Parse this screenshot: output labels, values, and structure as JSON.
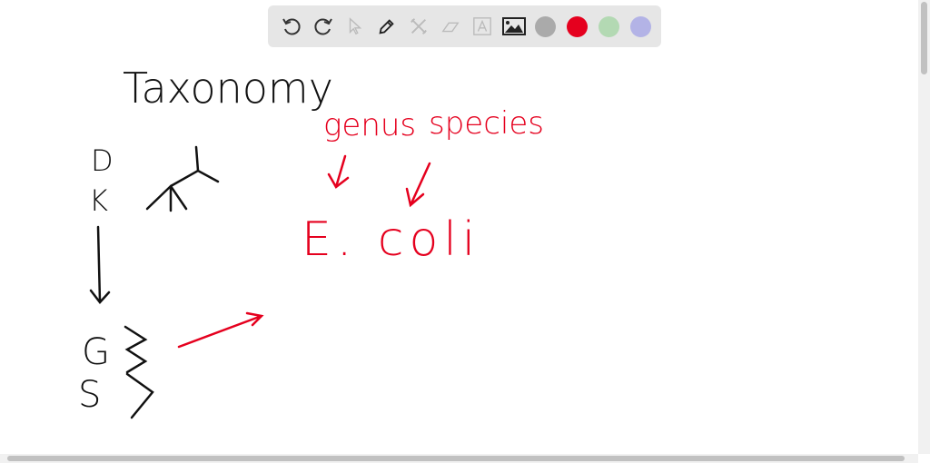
{
  "toolbar": {
    "tools": [
      "undo-icon",
      "redo-icon",
      "select-icon",
      "pen-icon",
      "tools-icon",
      "eraser-icon",
      "text-icon",
      "image-icon"
    ],
    "colors": [
      "#aaaaaa",
      "#e5001e",
      "#b3d9b3",
      "#b3b3e6"
    ],
    "selected_color": "#e5001e"
  },
  "board": {
    "title": "Taxonomy",
    "rank_d": "D",
    "rank_k": "K",
    "rank_g": "G",
    "rank_s": "S",
    "genus_label": "genus",
    "species_label": "species",
    "example": "E. coli"
  }
}
